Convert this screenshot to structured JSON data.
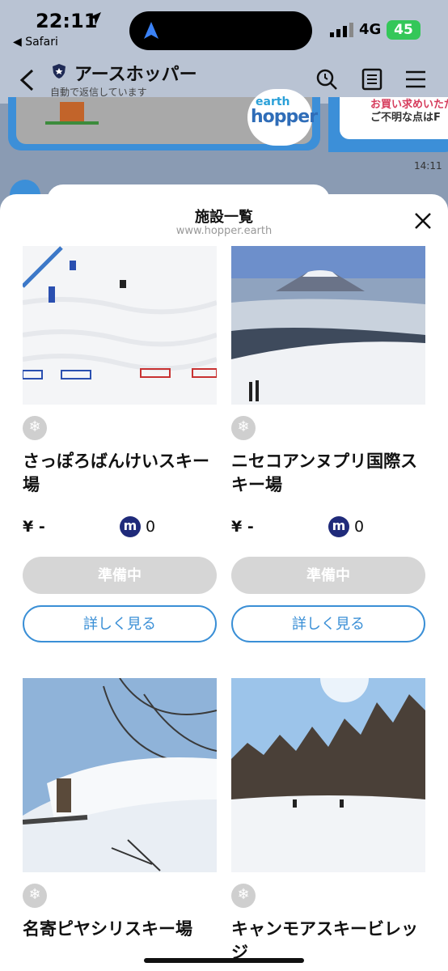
{
  "status": {
    "time": "22:11",
    "back_app": "◀ Safari",
    "network": "4G",
    "battery": "45"
  },
  "header": {
    "title": "アースホッパー",
    "subtitle": "自動で返信しています"
  },
  "chat": {
    "brand_top": "earth",
    "brand_bottom": "hopper",
    "card2_line1": "お買い求めいただ",
    "card2_line2": "ご不明な点はF",
    "time": "14:11"
  },
  "sheet": {
    "title": "施設一覧",
    "url": "www.hopper.earth",
    "facilities": [
      {
        "name": "さっぽろばんけいスキー場",
        "price": "¥ -",
        "m_label": "m",
        "m_value": "0",
        "prep_label": "準備中",
        "detail_label": "詳しく見る"
      },
      {
        "name": "ニセコアンヌプリ国際スキー場",
        "price": "¥ -",
        "m_label": "m",
        "m_value": "0",
        "prep_label": "準備中",
        "detail_label": "詳しく見る"
      },
      {
        "name": "名寄ピヤシリスキー場"
      },
      {
        "name": "キャンモアスキービレッジ"
      }
    ]
  },
  "icons": {
    "snow": "snowflake-icon",
    "search": "search-icon",
    "document": "document-icon",
    "menu": "menu-icon",
    "close": "close-icon",
    "back": "chevron-left-icon"
  }
}
